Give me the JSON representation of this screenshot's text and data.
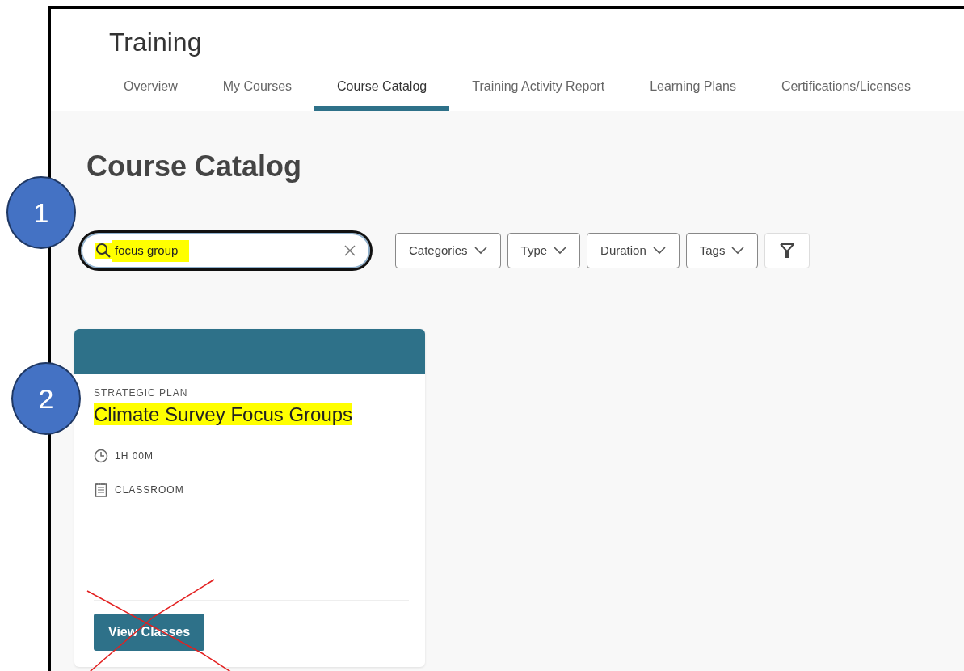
{
  "app_title": "Training",
  "tabs": [
    {
      "label": "Overview",
      "selected": false
    },
    {
      "label": "My Courses",
      "selected": false
    },
    {
      "label": "Course Catalog",
      "selected": true
    },
    {
      "label": "Training Activity Report",
      "selected": false
    },
    {
      "label": "Learning Plans",
      "selected": false
    },
    {
      "label": "Certifications/Licenses",
      "selected": false
    }
  ],
  "page_title": "Course Catalog",
  "search": {
    "value": "focus group",
    "highlighted": true
  },
  "filters": [
    {
      "kind": "dropdown",
      "label": "Categories"
    },
    {
      "kind": "dropdown",
      "label": "Type"
    },
    {
      "kind": "dropdown",
      "label": "Duration"
    },
    {
      "kind": "dropdown",
      "label": "Tags"
    },
    {
      "kind": "icon"
    }
  ],
  "courses": [
    {
      "category": "STRATEGIC PLAN",
      "title": "Climate Survey Focus Groups",
      "title_highlighted": true,
      "details": [
        {
          "kind": "duration",
          "text": "1H 00M"
        },
        {
          "kind": "format",
          "text": "CLASSROOM"
        }
      ],
      "button": "View Classes",
      "button_crossed_out": true
    }
  ],
  "callouts": [
    "1",
    "2"
  ]
}
